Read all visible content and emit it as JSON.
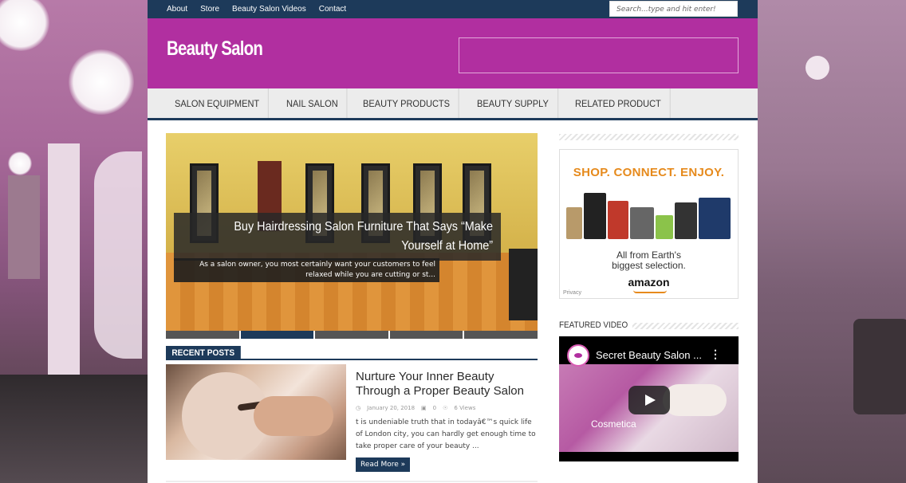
{
  "topnav": {
    "items": [
      "About",
      "Store",
      "Beauty Salon Videos",
      "Contact"
    ],
    "search_placeholder": "Search...type and hit enter!"
  },
  "header": {
    "site_title": "Beauty Salon"
  },
  "mainnav": {
    "items": [
      "SALON EQUIPMENT",
      "NAIL SALON",
      "BEAUTY PRODUCTS",
      "BEAUTY SUPPLY",
      "RELATED PRODUCT"
    ]
  },
  "slider": {
    "title": "Buy Hairdressing Salon Furniture That Says “Make Yourself at Home”",
    "excerpt": "As a salon owner, you most certainly want your customers to feel relaxed while you are cutting or st...",
    "slide_count": 5,
    "active_slide": 2
  },
  "recent_posts": {
    "heading": "RECENT POSTS",
    "post": {
      "title": "Nurture Your Inner Beauty Through a Proper Beauty Salon",
      "date": "January 20, 2018",
      "comments": "0",
      "views": "6 Views",
      "excerpt": "t is undeniable truth that in todayâ€™s quick life of London city, you can hardly get enough time to take proper care of your beauty ...",
      "read_more": "Read More »"
    }
  },
  "sidebar": {
    "amazon": {
      "headline": "SHOP. CONNECT. ENJOY.",
      "sub_line1": "All from Earth's",
      "sub_line2": "biggest selection.",
      "logo": "amazon",
      "privacy": "Privacy"
    },
    "featured_video": {
      "heading": "FEATURED VIDEO",
      "title": "Secret Beauty Salon ...",
      "channel_label": "Cosmetica"
    }
  },
  "colors": {
    "navy": "#1d3a5a",
    "magenta": "#b12fa0",
    "amazon_orange": "#e68a1c"
  }
}
